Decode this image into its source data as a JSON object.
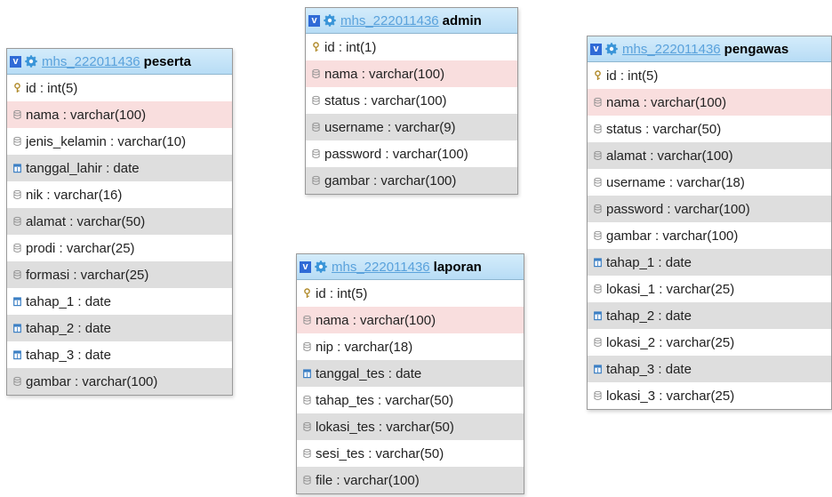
{
  "colors": {
    "header_gradient_top": "#d4ecfb",
    "header_gradient_bottom": "#b7dcf5",
    "db_link": "#5aa2dc",
    "toggle": "#2f6ad6",
    "row_alt": "#dedede",
    "row_highlight": "#f9dede"
  },
  "tables": [
    {
      "db": "mhs_222011436",
      "name": "peserta",
      "toggle": "v",
      "fields": [
        {
          "text": "id : int(5)",
          "icon": "key-icon",
          "bg": "w"
        },
        {
          "text": "nama : varchar(100)",
          "icon": "column-icon",
          "bg": "p"
        },
        {
          "text": "jenis_kelamin : varchar(10)",
          "icon": "column-icon",
          "bg": "w"
        },
        {
          "text": "tanggal_lahir : date",
          "icon": "date-icon",
          "bg": "g"
        },
        {
          "text": "nik : varchar(16)",
          "icon": "column-icon",
          "bg": "w"
        },
        {
          "text": "alamat : varchar(50)",
          "icon": "column-icon",
          "bg": "g"
        },
        {
          "text": "prodi : varchar(25)",
          "icon": "column-icon",
          "bg": "w"
        },
        {
          "text": "formasi : varchar(25)",
          "icon": "column-icon",
          "bg": "g"
        },
        {
          "text": "tahap_1 : date",
          "icon": "date-icon",
          "bg": "w"
        },
        {
          "text": "tahap_2 : date",
          "icon": "date-icon",
          "bg": "g"
        },
        {
          "text": "tahap_3 : date",
          "icon": "date-icon",
          "bg": "w"
        },
        {
          "text": "gambar : varchar(100)",
          "icon": "column-icon",
          "bg": "g"
        }
      ]
    },
    {
      "db": "mhs_222011436",
      "name": "admin",
      "toggle": "v",
      "fields": [
        {
          "text": "id : int(1)",
          "icon": "key-icon",
          "bg": "w"
        },
        {
          "text": "nama : varchar(100)",
          "icon": "column-icon",
          "bg": "p"
        },
        {
          "text": "status : varchar(100)",
          "icon": "column-icon",
          "bg": "w"
        },
        {
          "text": "username : varchar(9)",
          "icon": "column-icon",
          "bg": "g"
        },
        {
          "text": "password : varchar(100)",
          "icon": "column-icon",
          "bg": "w"
        },
        {
          "text": "gambar : varchar(100)",
          "icon": "column-icon",
          "bg": "g"
        }
      ]
    },
    {
      "db": "mhs_222011436",
      "name": "laporan",
      "toggle": "v",
      "fields": [
        {
          "text": "id : int(5)",
          "icon": "key-icon",
          "bg": "w"
        },
        {
          "text": "nama : varchar(100)",
          "icon": "column-icon",
          "bg": "p"
        },
        {
          "text": "nip : varchar(18)",
          "icon": "column-icon",
          "bg": "w"
        },
        {
          "text": "tanggal_tes : date",
          "icon": "date-icon",
          "bg": "g"
        },
        {
          "text": "tahap_tes : varchar(50)",
          "icon": "column-icon",
          "bg": "w"
        },
        {
          "text": "lokasi_tes : varchar(50)",
          "icon": "column-icon",
          "bg": "g"
        },
        {
          "text": "sesi_tes : varchar(50)",
          "icon": "column-icon",
          "bg": "w"
        },
        {
          "text": "file : varchar(100)",
          "icon": "column-icon",
          "bg": "g"
        }
      ]
    },
    {
      "db": "mhs_222011436",
      "name": "pengawas",
      "toggle": "v",
      "fields": [
        {
          "text": "id : int(5)",
          "icon": "key-icon",
          "bg": "w"
        },
        {
          "text": "nama : varchar(100)",
          "icon": "column-icon",
          "bg": "p"
        },
        {
          "text": "status : varchar(50)",
          "icon": "column-icon",
          "bg": "w"
        },
        {
          "text": "alamat : varchar(100)",
          "icon": "column-icon",
          "bg": "g"
        },
        {
          "text": "username : varchar(18)",
          "icon": "column-icon",
          "bg": "w"
        },
        {
          "text": "password : varchar(100)",
          "icon": "column-icon",
          "bg": "g"
        },
        {
          "text": "gambar : varchar(100)",
          "icon": "column-icon",
          "bg": "w"
        },
        {
          "text": "tahap_1 : date",
          "icon": "date-icon",
          "bg": "g"
        },
        {
          "text": "lokasi_1 : varchar(25)",
          "icon": "column-icon",
          "bg": "w"
        },
        {
          "text": "tahap_2 : date",
          "icon": "date-icon",
          "bg": "g"
        },
        {
          "text": "lokasi_2 : varchar(25)",
          "icon": "column-icon",
          "bg": "w"
        },
        {
          "text": "tahap_3 : date",
          "icon": "date-icon",
          "bg": "g"
        },
        {
          "text": "lokasi_3 : varchar(25)",
          "icon": "column-icon",
          "bg": "w"
        }
      ]
    }
  ]
}
